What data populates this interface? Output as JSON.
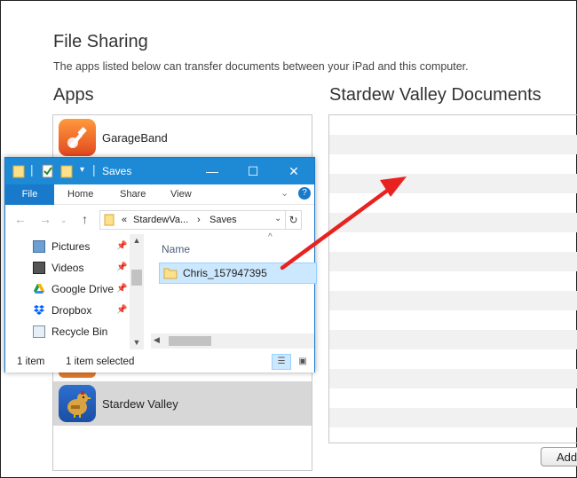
{
  "itunes": {
    "title": "File Sharing",
    "description": "The apps listed below can transfer documents between your iPad and this computer.",
    "apps_heading": "Apps",
    "documents_heading": "Stardew Valley Documents",
    "apps": [
      {
        "name": "GarageBand",
        "icon": "garageband-icon"
      },
      {
        "name": "Stardew Valley",
        "icon": "stardew-valley-icon"
      }
    ],
    "add_button": "Add"
  },
  "explorer": {
    "title": "Saves",
    "ribbon_tabs": [
      "File",
      "Home",
      "Share",
      "View"
    ],
    "address": {
      "overflow": "«",
      "parent": "StardewVa...",
      "separator": "›",
      "current": "Saves"
    },
    "nav_items": [
      {
        "label": "Pictures",
        "icon": "pictures-icon"
      },
      {
        "label": "Videos",
        "icon": "videos-icon"
      },
      {
        "label": "Google Drive",
        "icon": "google-drive-icon"
      },
      {
        "label": "Dropbox",
        "icon": "dropbox-icon"
      },
      {
        "label": "Recycle Bin",
        "icon": "recycle-bin-icon"
      }
    ],
    "column_header": "Name",
    "files": [
      {
        "name": "Chris_157947395",
        "type": "folder"
      }
    ],
    "status": {
      "count": "1 item",
      "selected": "1 item selected"
    }
  },
  "colors": {
    "accent": "#1979ca",
    "titlebar": "#1e8ad6",
    "arrow": "#e8231f",
    "selection": "#cce8ff"
  }
}
